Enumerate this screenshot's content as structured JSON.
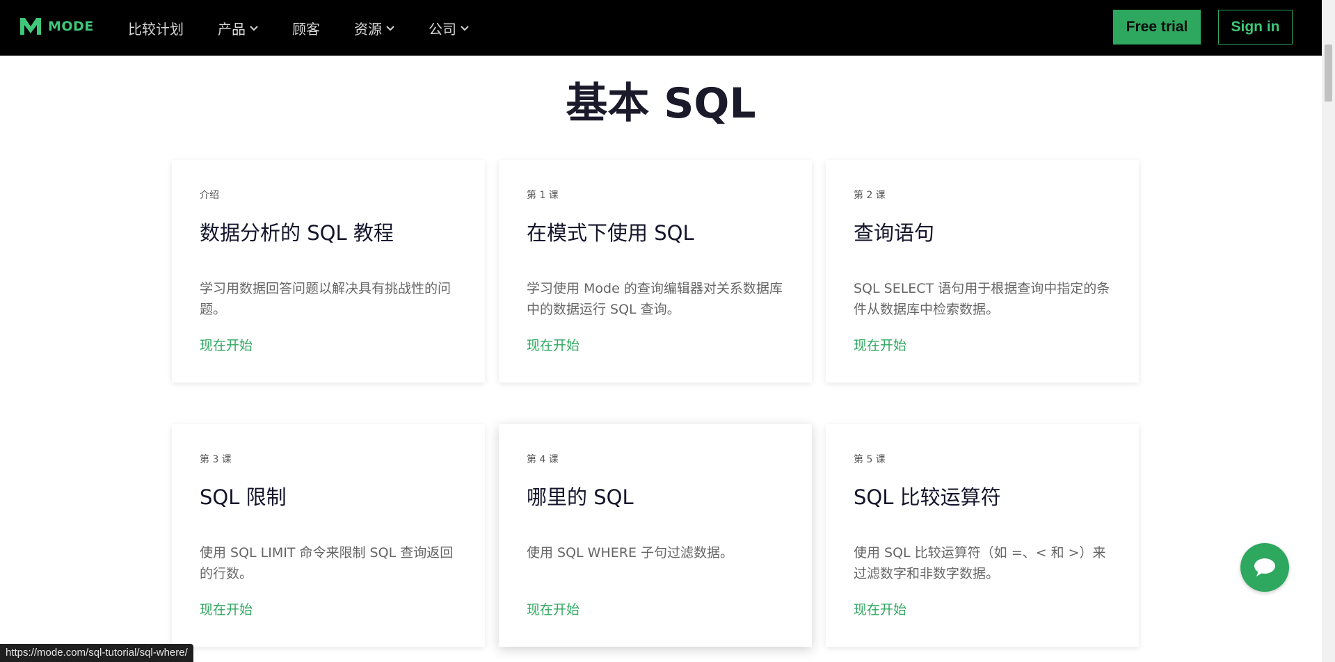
{
  "nav": {
    "logo_text": "MODE",
    "items": [
      {
        "label": "比较计划",
        "dropdown": false
      },
      {
        "label": "产品",
        "dropdown": true
      },
      {
        "label": "顾客",
        "dropdown": false
      },
      {
        "label": "资源",
        "dropdown": true
      },
      {
        "label": "公司",
        "dropdown": true
      }
    ],
    "free_trial": "Free trial",
    "sign_in": "Sign in"
  },
  "page": {
    "title": "基本 SQL"
  },
  "cards": [
    {
      "tag": "介绍",
      "title": "数据分析的 SQL 教程",
      "desc": "学习用数据回答问题以解决具有挑战性的问题。",
      "cta": "现在开始"
    },
    {
      "tag": "第 1 课",
      "title": "在模式下使用 SQL",
      "desc": "学习使用 Mode 的查询编辑器对关系数据库中的数据运行 SQL 查询。",
      "cta": "现在开始"
    },
    {
      "tag": "第 2 课",
      "title": "查询语句",
      "desc": "SQL SELECT 语句用于根据查询中指定的条件从数据库中检索数据。",
      "cta": "现在开始"
    },
    {
      "tag": "第 3 课",
      "title": "SQL 限制",
      "desc": "使用 SQL LIMIT 命令来限制 SQL 查询返回的行数。",
      "cta": "现在开始"
    },
    {
      "tag": "第 4 课",
      "title": "哪里的 SQL",
      "desc": "使用 SQL WHERE 子句过滤数据。",
      "cta": "现在开始"
    },
    {
      "tag": "第 5 课",
      "title": "SQL 比较运算符",
      "desc": "使用 SQL 比较运算符（如 =、< 和 >）来过滤数字和非数字数据。",
      "cta": "现在开始"
    }
  ],
  "status_bar": {
    "url": "https://mode.com/sql-tutorial/sql-where/"
  },
  "colors": {
    "brand_green": "#2ea75f",
    "nav_bg": "#000000"
  }
}
